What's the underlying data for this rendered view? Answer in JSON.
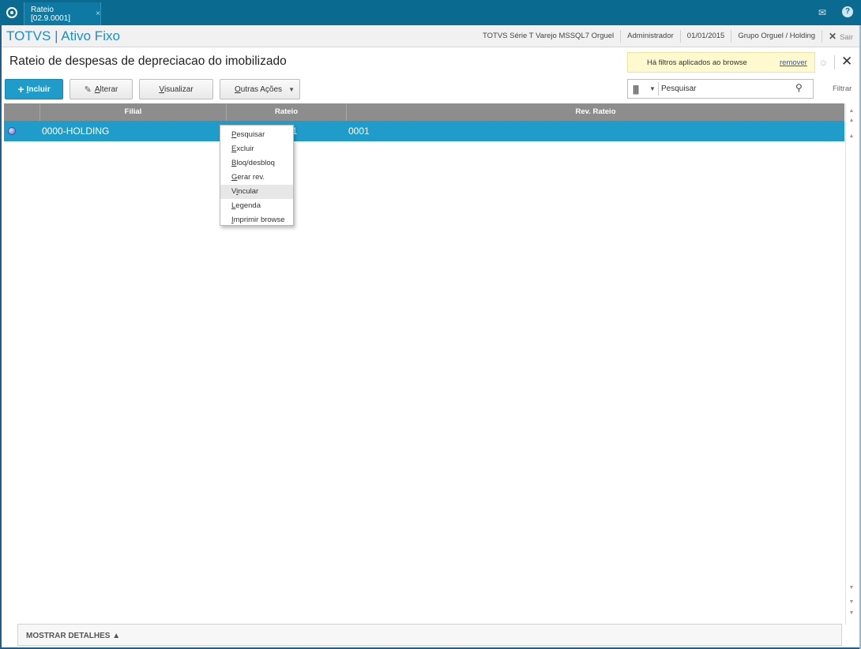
{
  "topbar": {
    "tab_title": "Rateio [02.9.0001]",
    "tab_close": "×",
    "mail_icon": "✉",
    "help_icon": "?"
  },
  "header": {
    "app_title": "TOTVS | Ativo Fixo",
    "environment": "TOTVS Série T Varejo MSSQL7 Orguel",
    "user": "Administrador",
    "date": "01/01/2015",
    "company": "Grupo Orguel / Holding",
    "exit_label": "Sair"
  },
  "page": {
    "title": "Rateio de despesas de depreciacao do imobilizado"
  },
  "filter_notice": {
    "text": "Há filtros aplicados ao browse",
    "remove_link": "remover"
  },
  "toolbar": {
    "include": {
      "label": "Incluir",
      "accent": "I",
      "rest": "ncluir"
    },
    "alter": {
      "accent": "A",
      "rest": "lterar"
    },
    "view": {
      "accent": "V",
      "rest": "isualizar"
    },
    "other": {
      "accent": "O",
      "rest": "utras Ações"
    }
  },
  "search": {
    "value": "Pesquisar",
    "filter_label": "Filtrar"
  },
  "grid": {
    "columns": [
      "Filial",
      "Rateio",
      "Rev. Rateio"
    ],
    "rows": [
      {
        "filial": "0000-HOLDING",
        "rateio": "01",
        "rev_rateio": "0001"
      }
    ]
  },
  "other_actions_menu": {
    "items": [
      {
        "accent": "P",
        "rest": "esquisar"
      },
      {
        "accent": "E",
        "rest": "xcluir"
      },
      {
        "accent": "B",
        "rest": "loq/desbloq"
      },
      {
        "accent": "G",
        "rest": "erar rev."
      },
      {
        "pre": "V",
        "accent": "i",
        "rest": "ncular"
      },
      {
        "accent": "L",
        "rest": "egenda"
      },
      {
        "accent": "I",
        "rest": "mprimir browse"
      }
    ]
  },
  "footer": {
    "details_label": "MOSTRAR DETALHES ▲"
  },
  "colors": {
    "accent": "#1f9cc9",
    "topbar": "#0b6a8f",
    "title_blue": "#1a8fc9"
  }
}
